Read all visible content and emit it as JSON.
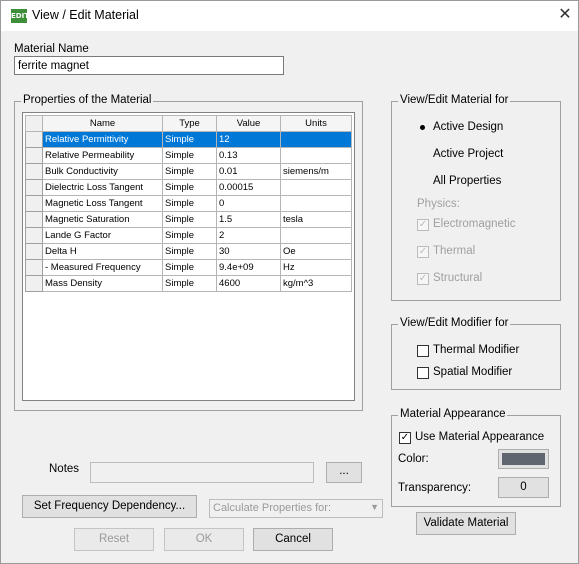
{
  "window": {
    "title": "View / Edit Material",
    "icon_text": "EDIT"
  },
  "material_name": {
    "label": "Material Name",
    "value": "ferrite magnet"
  },
  "properties": {
    "legend": "Properties of the Material",
    "columns": [
      "Name",
      "Type",
      "Value",
      "Units"
    ],
    "rows": [
      {
        "name": "Relative Permittivity",
        "type": "Simple",
        "value": "12",
        "units": ""
      },
      {
        "name": "Relative Permeability",
        "type": "Simple",
        "value": "0.13",
        "units": ""
      },
      {
        "name": "Bulk Conductivity",
        "type": "Simple",
        "value": "0.01",
        "units": "siemens/m"
      },
      {
        "name": "Dielectric Loss Tangent",
        "type": "Simple",
        "value": "0.00015",
        "units": ""
      },
      {
        "name": "Magnetic Loss Tangent",
        "type": "Simple",
        "value": "0",
        "units": ""
      },
      {
        "name": "Magnetic Saturation",
        "type": "Simple",
        "value": "1.5",
        "units": "tesla"
      },
      {
        "name": "Lande G Factor",
        "type": "Simple",
        "value": "2",
        "units": ""
      },
      {
        "name": "Delta H",
        "type": "Simple",
        "value": "30",
        "units": "Oe"
      },
      {
        "name": "- Measured Frequency",
        "type": "Simple",
        "value": "9.4e+09",
        "units": "Hz"
      },
      {
        "name": "Mass Density",
        "type": "Simple",
        "value": "4600",
        "units": "kg/m^3"
      }
    ],
    "selected_row": 0
  },
  "view_edit_for": {
    "legend": "View/Edit Material for",
    "options": [
      "Active Design",
      "Active Project",
      "All Properties"
    ],
    "selected": "Active Design",
    "physics_label": "Physics:",
    "physics": [
      {
        "label": "Electromagnetic",
        "checked": true,
        "enabled": false
      },
      {
        "label": "Thermal",
        "checked": true,
        "enabled": false
      },
      {
        "label": "Structural",
        "checked": true,
        "enabled": false
      }
    ]
  },
  "modifier_for": {
    "legend": "View/Edit Modifier for",
    "thermal_label": "Thermal Modifier",
    "thermal_checked": false,
    "spatial_label": "Spatial Modifier",
    "spatial_checked": false
  },
  "appearance": {
    "legend": "Material Appearance",
    "use_label": "Use Material Appearance",
    "use_checked": true,
    "color_label": "Color:",
    "color_value": "#5f6670",
    "transparency_label": "Transparency:",
    "transparency_value": "0"
  },
  "notes": {
    "label": "Notes",
    "value": "",
    "browse_label": "..."
  },
  "buttons": {
    "set_frequency": "Set Frequency Dependency...",
    "calculate_placeholder": "Calculate Properties for:",
    "validate": "Validate Material",
    "reset": "Reset",
    "ok": "OK",
    "cancel": "Cancel"
  }
}
